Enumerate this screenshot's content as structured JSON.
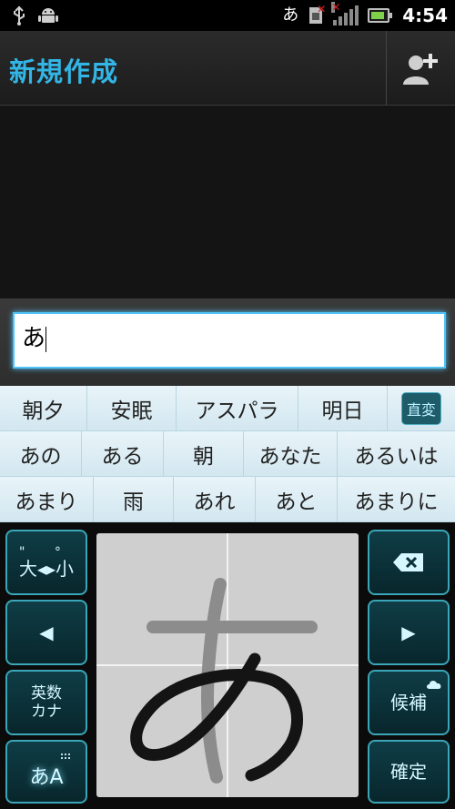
{
  "status_bar": {
    "input_mode": "あ",
    "time": "4:54",
    "icons": [
      "usb-icon",
      "android-icon",
      "sim-missing-icon",
      "signal-no-service-icon",
      "battery-charging-icon"
    ]
  },
  "header": {
    "title": "新規作成",
    "add_contact_icon": "add-contact-icon"
  },
  "compose": {
    "input_value": "あ"
  },
  "candidates": {
    "row1": [
      "朝夕",
      "安眠",
      "アスパラ",
      "明日"
    ],
    "convert_label": "直変",
    "row2": [
      "あの",
      "ある",
      "朝",
      "あなた",
      "あるいは"
    ],
    "row3": [
      "あまり",
      "雨",
      "あれ",
      "あと",
      "あまりに"
    ]
  },
  "keyboard": {
    "case_toggle_label": "大◂▸小",
    "alpha_kana_label_line1": "英数",
    "alpha_kana_label_line2": "カナ",
    "mode_label": "あA",
    "candidates_label": "候補",
    "confirm_label": "確定",
    "left_arrow": "◀",
    "right_arrow": "▶",
    "accent_color": "#3aa6b7"
  }
}
